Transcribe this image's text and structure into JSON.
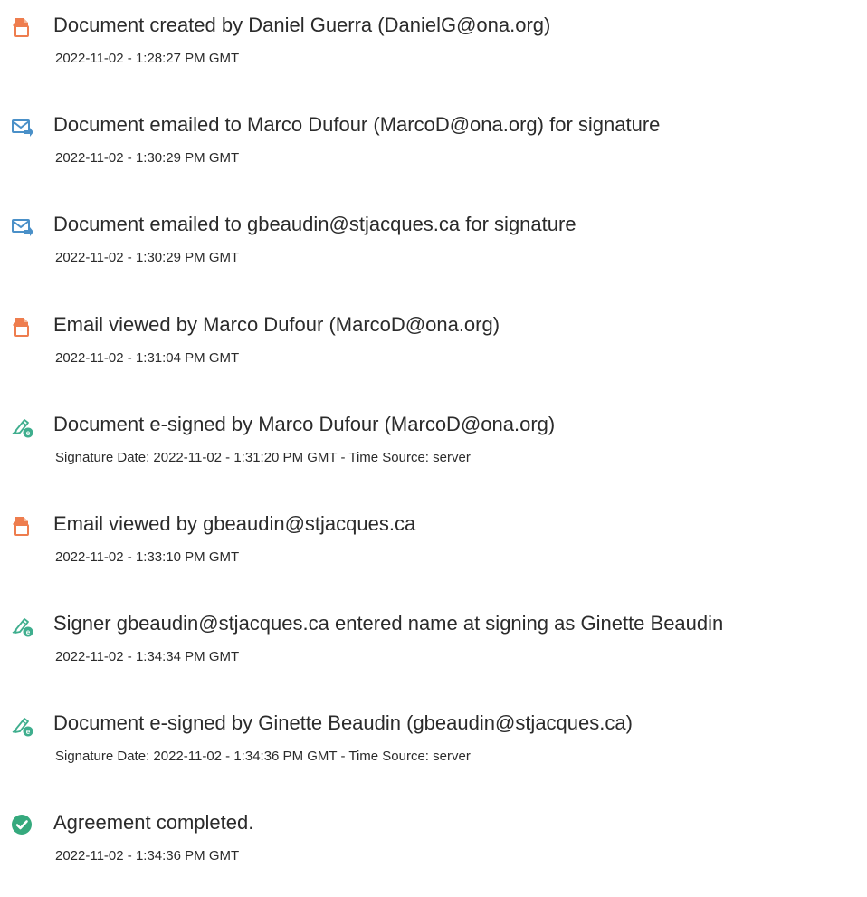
{
  "colors": {
    "document_icon": "#ee7d4e",
    "email_icon": "#4a90c8",
    "sign_icon": "#3fae8e",
    "complete_icon": "#35a97d",
    "text": "#2b2b2b"
  },
  "events": [
    {
      "icon": "document-icon",
      "title": "Document created by Daniel Guerra (DanielG@ona.org)",
      "detail": "2022-11-02 - 1:28:27 PM GMT"
    },
    {
      "icon": "email-sent-icon",
      "title": "Document emailed to Marco Dufour (MarcoD@ona.org) for signature",
      "detail": "2022-11-02 - 1:30:29 PM GMT"
    },
    {
      "icon": "email-sent-icon",
      "title": "Document emailed to gbeaudin@stjacques.ca for signature",
      "detail": "2022-11-02 - 1:30:29 PM GMT"
    },
    {
      "icon": "document-icon",
      "title": "Email viewed by Marco Dufour (MarcoD@ona.org)",
      "detail": "2022-11-02 - 1:31:04 PM GMT"
    },
    {
      "icon": "e-sign-pen-icon",
      "title": "Document e-signed by Marco Dufour (MarcoD@ona.org)",
      "detail": "Signature Date: 2022-11-02 - 1:31:20 PM GMT - Time Source: server"
    },
    {
      "icon": "document-icon",
      "title": "Email viewed by gbeaudin@stjacques.ca",
      "detail": "2022-11-02 - 1:33:10 PM GMT"
    },
    {
      "icon": "e-sign-pen-icon",
      "title": "Signer gbeaudin@stjacques.ca entered name at signing as Ginette Beaudin",
      "detail": "2022-11-02 - 1:34:34 PM GMT"
    },
    {
      "icon": "e-sign-pen-icon",
      "title": "Document e-signed by Ginette Beaudin (gbeaudin@stjacques.ca)",
      "detail": "Signature Date: 2022-11-02 - 1:34:36 PM GMT - Time Source: server"
    },
    {
      "icon": "checkmark-circle-icon",
      "title": "Agreement completed.",
      "detail": "2022-11-02 - 1:34:36 PM GMT"
    }
  ]
}
